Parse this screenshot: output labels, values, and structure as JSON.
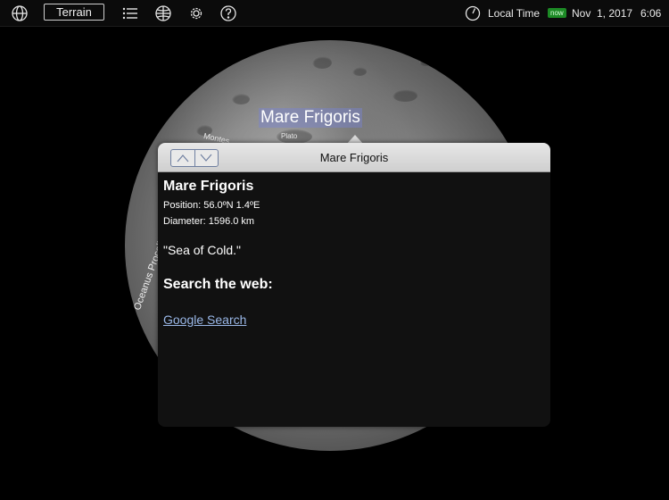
{
  "toolbar": {
    "icons": [
      "globe-icon",
      "list-icon",
      "grid-globe-icon",
      "gear-icon",
      "help-icon",
      "clock-icon"
    ],
    "terrain_label": "Terrain",
    "time_mode": "Local Time",
    "now_badge": "now",
    "date": "Nov  1, 2017",
    "time": "6:06"
  },
  "map": {
    "labels": {
      "main": "Mare Frigoris",
      "plato": "Plato",
      "montes": "Montes",
      "oceanus": "Oceanus Procellarum"
    }
  },
  "popup": {
    "title": "Mare Frigoris",
    "nav": {
      "up_icon": "chevron-up-icon",
      "down_icon": "chevron-down-icon"
    },
    "name": "Mare Frigoris",
    "position": "Position: 56.0ºN 1.4ºE",
    "diameter": "Diameter: 1596.0 km",
    "description": "\"Sea of Cold.\"",
    "search_heading": "Search the web:",
    "google_link": "Google Search"
  },
  "colors": {
    "popup_header": "#d9d9d9",
    "popup_body": "#111111",
    "link": "#9ab8e8",
    "now_badge": "#1c8a25",
    "label_highlight": "#7882d2"
  }
}
